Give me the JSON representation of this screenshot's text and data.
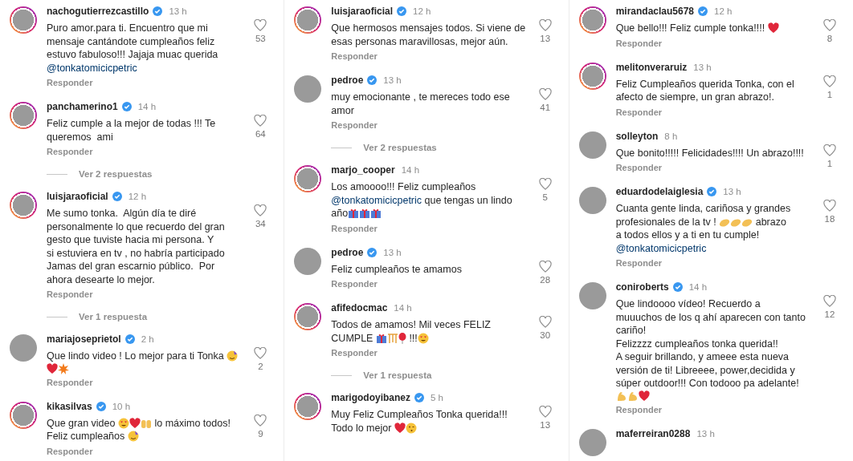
{
  "columns": [
    {
      "items": [
        {
          "kind": "comment",
          "username": "nachogutierrezcastillo",
          "verified": true,
          "ring": true,
          "time": "13 h",
          "lines": [
            [
              {
                "text": "Puro amor.para ti. Encuentro que mi"
              }
            ],
            [
              {
                "text": "mensaje cantándote cumpleaños feliz"
              }
            ],
            [
              {
                "text": "estuvo fabuloso!!! Jajaja muac querida"
              }
            ],
            [
              {
                "mention": "@tonkatomicicpetric"
              }
            ]
          ],
          "likes": "53",
          "reply": "Responder"
        },
        {
          "kind": "comment",
          "username": "panchamerino1",
          "verified": true,
          "ring": true,
          "time": "14 h",
          "lines": [
            [
              {
                "text": "Feliz cumple a la mejor de todas !!! Te"
              }
            ],
            [
              {
                "text": "queremos  ami"
              }
            ]
          ],
          "likes": "64",
          "reply": "Responder"
        },
        {
          "kind": "replies",
          "label": "Ver 2 respuestas"
        },
        {
          "kind": "comment",
          "username": "luisjaraoficial",
          "verified": true,
          "ring": true,
          "time": "12 h",
          "lines": [
            [
              {
                "text": "Me sumo tonka.  Algún día te diré"
              }
            ],
            [
              {
                "text": "personalmente lo que recuerdo del gran"
              }
            ],
            [
              {
                "text": "gesto que tuviste hacia mi persona. Y"
              }
            ],
            [
              {
                "text": "si estuviera en tv , no habría participado"
              }
            ],
            [
              {
                "text": "Jamas del gran escarnio público.  Por"
              }
            ],
            [
              {
                "text": "ahora desearte lo mejor."
              }
            ]
          ],
          "likes": "34",
          "reply": "Responder"
        },
        {
          "kind": "replies",
          "label": "Ver 1 respuesta"
        },
        {
          "kind": "comment",
          "username": "mariajoseprietol",
          "verified": true,
          "ring": false,
          "time": "2 h",
          "lines": [
            [
              {
                "text": "Que lindo video ! Lo mejor para ti Tonka "
              },
              {
                "kind": "party"
              }
            ],
            [
              {
                "kind": "heart"
              },
              {
                "kind": "burst"
              }
            ]
          ],
          "likes": "2",
          "reply": "Responder"
        },
        {
          "kind": "comment",
          "username": "kikasilvas",
          "verified": true,
          "ring": true,
          "time": "10 h",
          "lines": [
            [
              {
                "text": "Que gran video "
              },
              {
                "kind": "hearteyes"
              },
              {
                "kind": "heart"
              },
              {
                "kind": "hands"
              },
              {
                "text": " lo máximo todos!"
              }
            ],
            [
              {
                "text": "Feliz cumpleaños "
              },
              {
                "kind": "party"
              }
            ]
          ],
          "likes": "9",
          "reply": "Responder"
        }
      ]
    },
    {
      "items": [
        {
          "kind": "comment",
          "username": "luisjaraoficial",
          "verified": true,
          "ring": true,
          "time": "12 h",
          "lines": [
            [
              {
                "text": "Que hermosos mensajes todos. Si viene de"
              }
            ],
            [
              {
                "text": "esas personas maravillosas, mejor aún."
              }
            ]
          ],
          "likes": "13",
          "reply": "Responder"
        },
        {
          "kind": "comment",
          "username": "pedroe",
          "verified": true,
          "ring": false,
          "time": "13 h",
          "lines": [
            [
              {
                "text": "muy emocionante , te mereces todo ese"
              }
            ],
            [
              {
                "text": "amor"
              }
            ]
          ],
          "likes": "41",
          "reply": "Responder"
        },
        {
          "kind": "replies",
          "label": "Ver 2 respuestas"
        },
        {
          "kind": "comment",
          "username": "marjo_cooper",
          "verified": false,
          "ring": true,
          "time": "14 h",
          "lines": [
            [
              {
                "text": "Los amoooo!!! Feliz cumpleaños"
              }
            ],
            [
              {
                "mention": "@tonkatomicicpetric"
              },
              {
                "text": " que tengas un lindo"
              }
            ],
            [
              {
                "text": "año"
              },
              {
                "kind": "gift"
              },
              {
                "kind": "gift"
              },
              {
                "kind": "gift"
              }
            ]
          ],
          "likes": "5",
          "reply": "Responder"
        },
        {
          "kind": "comment",
          "username": "pedroe",
          "verified": true,
          "ring": false,
          "time": "13 h",
          "lines": [
            [
              {
                "text": "Feliz cumpleaños te amamos"
              }
            ]
          ],
          "likes": "28",
          "reply": "Responder"
        },
        {
          "kind": "comment",
          "username": "afifedocmac",
          "verified": false,
          "ring": true,
          "time": "14 h",
          "lines": [
            [
              {
                "text": "Todos de amamos! Mil veces FELIZ"
              }
            ],
            [
              {
                "text": "CUMPLE "
              },
              {
                "kind": "gift"
              },
              {
                "kind": "confetti"
              },
              {
                "kind": "balloon"
              },
              {
                "text": " !!!"
              },
              {
                "kind": "hearteyes"
              }
            ]
          ],
          "likes": "30",
          "reply": "Responder"
        },
        {
          "kind": "replies",
          "label": "Ver 1 respuesta"
        },
        {
          "kind": "comment",
          "username": "marigodoyibanez",
          "verified": true,
          "ring": true,
          "time": "5 h",
          "lines": [
            [
              {
                "text": "Muy Feliz Cumpleaños Tonka querida!!!"
              }
            ],
            [
              {
                "text": "Todo lo mejor "
              },
              {
                "kind": "heart"
              },
              {
                "kind": "kiss"
              }
            ]
          ],
          "likes": "13"
        }
      ]
    },
    {
      "items": [
        {
          "kind": "comment",
          "username": "mirandaclau5678",
          "verified": true,
          "ring": true,
          "time": "12 h",
          "lines": [
            [
              {
                "text": "Que bello!!! Feliz cumple tonka!!!! "
              },
              {
                "kind": "heart"
              }
            ]
          ],
          "likes": "8",
          "reply": "Responder"
        },
        {
          "kind": "comment",
          "username": "melitonveraruiz",
          "verified": false,
          "ring": true,
          "time": "13 h",
          "lines": [
            [
              {
                "text": "Feliz Cumpleaños querida Tonka, con el"
              }
            ],
            [
              {
                "text": "afecto de siempre, un gran abrazo!."
              }
            ]
          ],
          "likes": "1",
          "reply": "Responder"
        },
        {
          "kind": "comment",
          "username": "solleyton",
          "verified": false,
          "ring": false,
          "time": "8 h",
          "lines": [
            [
              {
                "text": "Que bonito!!!!! Felicidades!!!! Un abrazo!!!!"
              }
            ]
          ],
          "likes": "1",
          "reply": "Responder"
        },
        {
          "kind": "comment",
          "username": "eduardodelaiglesia",
          "verified": true,
          "ring": false,
          "time": "13 h",
          "lines": [
            [
              {
                "text": "Cuanta gente linda, cariñosa y grandes"
              }
            ],
            [
              {
                "text": "profesionales de la tv ! "
              },
              {
                "kind": "clap"
              },
              {
                "kind": "clap"
              },
              {
                "kind": "clap"
              },
              {
                "text": " abrazo"
              }
            ],
            [
              {
                "text": "a todos ellos y a ti en tu cumple!"
              }
            ],
            [
              {
                "mention": "@tonkatomicicpetric"
              }
            ]
          ],
          "likes": "18",
          "reply": "Responder"
        },
        {
          "kind": "comment",
          "username": "coniroberts",
          "verified": true,
          "ring": false,
          "time": "14 h",
          "lines": [
            [
              {
                "text": "Que lindoooo vídeo! Recuerdo a"
              }
            ],
            [
              {
                "text": "muuuchos de los q ahí aparecen con tanto"
              }
            ],
            [
              {
                "text": "cariño!"
              }
            ],
            [
              {
                "text": "Felizzzz cumpleaños tonka querida!!"
              }
            ],
            [
              {
                "text": "A seguir brillando, y ameee esta nueva"
              }
            ],
            [
              {
                "text": "versión de ti! Libreeee, power,decidida y"
              }
            ],
            [
              {
                "text": "súper outdoor!!! Con todooo pa adelante!"
              }
            ],
            [
              {
                "kind": "muscle"
              },
              {
                "kind": "muscle"
              },
              {
                "kind": "heart"
              }
            ]
          ],
          "likes": "12",
          "reply": "Responder"
        },
        {
          "kind": "comment",
          "username": "maferreiran0288",
          "verified": false,
          "ring": false,
          "time": "13 h"
        }
      ]
    }
  ]
}
